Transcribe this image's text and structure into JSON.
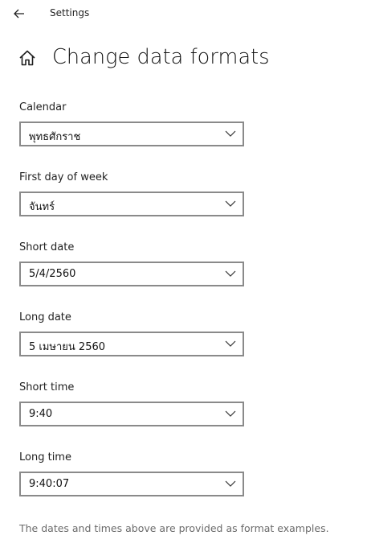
{
  "window": {
    "title": "Settings"
  },
  "page": {
    "title": "Change data formats"
  },
  "fields": [
    {
      "label": "Calendar",
      "value": "พุทธศักราช"
    },
    {
      "label": "First day of week",
      "value": "จันทร์"
    },
    {
      "label": "Short date",
      "value": "5/4/2560"
    },
    {
      "label": "Long date",
      "value": "5 เมษายน 2560"
    },
    {
      "label": "Short time",
      "value": "9:40"
    },
    {
      "label": "Long time",
      "value": "9:40:07"
    }
  ],
  "footer": {
    "note": "The dates and times above are provided as format examples."
  },
  "icons": {
    "back": "back-arrow-icon",
    "home": "home-icon",
    "dropdown": "chevron-down-icon"
  }
}
